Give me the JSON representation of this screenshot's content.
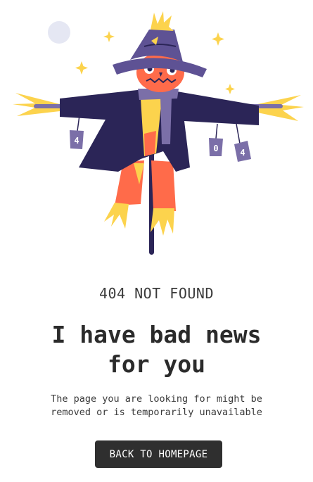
{
  "illustration": {
    "tin_labels": [
      "4",
      "0",
      "4"
    ],
    "icon": "scarecrow-illustration",
    "colors": {
      "hat": "#5e5294",
      "coat": "#2b2557",
      "face": "#ff6b4a",
      "straw": "#fcd34d",
      "scarf": "#7b6fa8",
      "pole": "#2b2557",
      "moon": "#e5e7f3",
      "sparkle": "#fcd34d"
    }
  },
  "status_text": "404 NOT FOUND",
  "headline": "I have bad news for you",
  "description": "The page you are looking for might be removed or is temporarily unavailable",
  "button": {
    "label": "BACK TO HOMEPAGE"
  },
  "colors": {
    "button_bg": "#2f2f2f",
    "button_text": "#ffffff",
    "text": "#2f2f2f"
  }
}
